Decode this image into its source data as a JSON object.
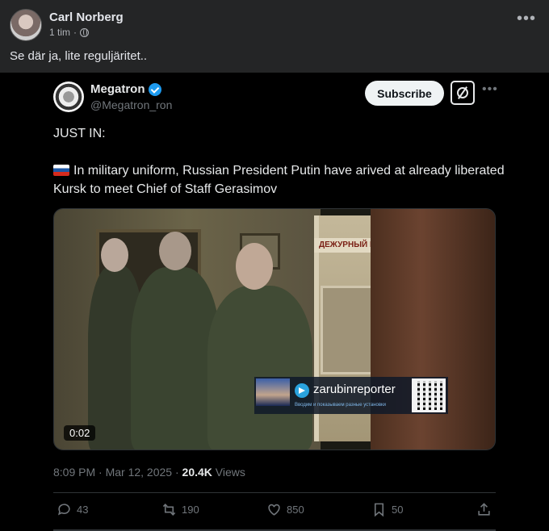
{
  "facebook_post": {
    "author": "Carl Norberg",
    "time": "1 tim",
    "separator": "·",
    "text": "Se där ja, lite reguljäritet.."
  },
  "tweet": {
    "name": "Megatron",
    "handle": "@Megatron_ron",
    "subscribe_label": "Subscribe",
    "just_in": "JUST IN:",
    "body": "In military uniform, Russian President Putin have arived at already liberated Kursk to meet Chief of Staff Gerasimov",
    "media": {
      "duration": "0:02",
      "sign_text": "ДЕЖУРНЫЙ ПО",
      "watermark": "zarubinreporter",
      "watermark_sub": "Вводим и показываем разные установки"
    },
    "timestamp": "8:09 PM · Mar 12, 2025 · ",
    "views_count": "20.4K",
    "views_label": " Views",
    "actions": {
      "replies": "43",
      "reposts": "190",
      "likes": "850",
      "bookmarks": "50"
    }
  },
  "colors": {
    "fb_background": "#242526",
    "tweet_background": "#000000",
    "verified": "#1d9bf0",
    "muted": "#71767b"
  }
}
